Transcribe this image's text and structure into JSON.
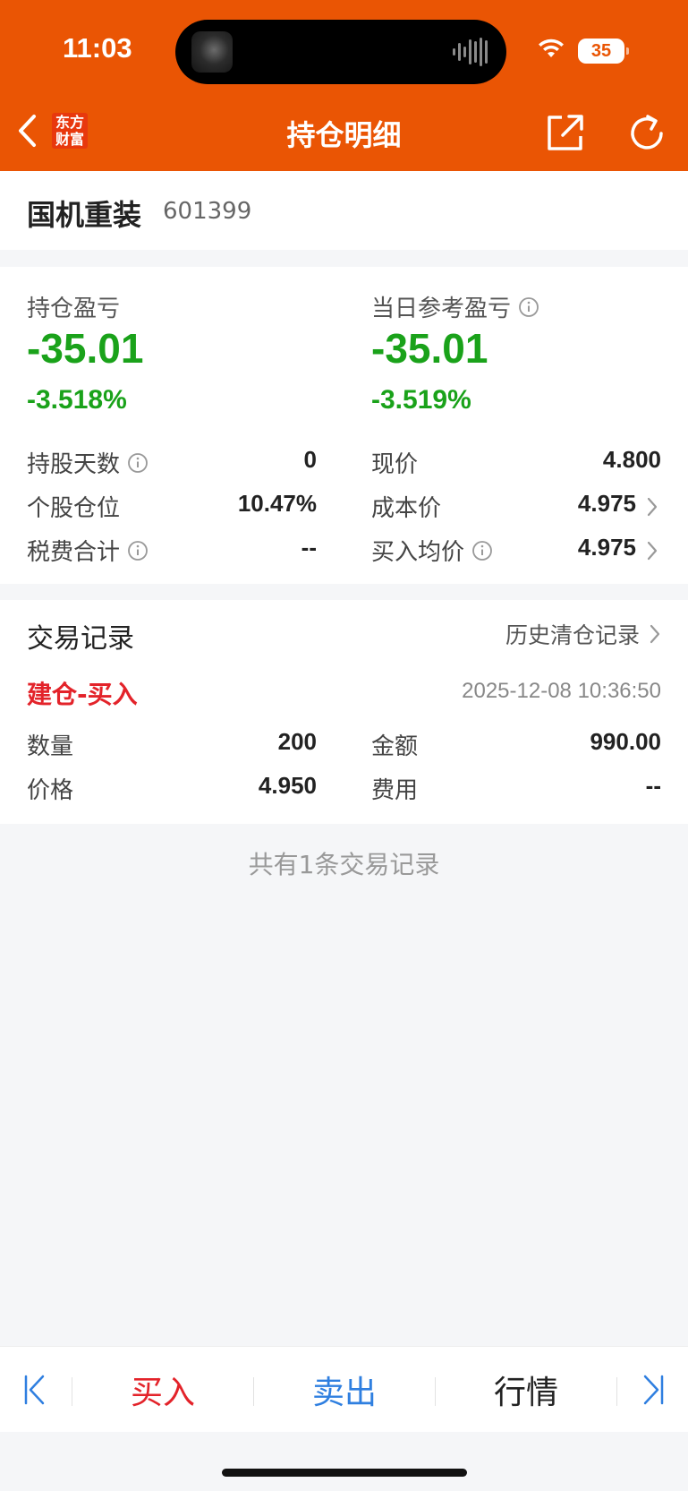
{
  "status": {
    "time": "11:03",
    "battery": "35"
  },
  "header": {
    "title": "持仓明细",
    "logo_line1": "东方",
    "logo_line2": "财富"
  },
  "stock": {
    "name": "国机重装",
    "code": "601399"
  },
  "holdings": {
    "position_pl_label": "持仓盈亏",
    "position_pl_value": "-35.01",
    "position_pl_pct": "-3.518%",
    "daily_pl_label": "当日参考盈亏",
    "daily_pl_value": "-35.01",
    "daily_pl_pct": "-3.519%",
    "rows_left": [
      {
        "label": "持股天数",
        "value": "0",
        "info": true
      },
      {
        "label": "个股仓位",
        "value": "10.47%",
        "info": false
      },
      {
        "label": "税费合计",
        "value": "--",
        "info": true
      }
    ],
    "rows_right": [
      {
        "label": "现价",
        "value": "4.800",
        "info": false,
        "chevron": false
      },
      {
        "label": "成本价",
        "value": "4.975",
        "info": false,
        "chevron": true
      },
      {
        "label": "买入均价",
        "value": "4.975",
        "info": true,
        "chevron": true
      }
    ]
  },
  "trades": {
    "title": "交易记录",
    "history_link": "历史清仓记录",
    "record": {
      "type": "建仓-买入",
      "time": "2025-12-08 10:36:50",
      "qty_label": "数量",
      "qty_value": "200",
      "amount_label": "金额",
      "amount_value": "990.00",
      "price_label": "价格",
      "price_value": "4.950",
      "fee_label": "费用",
      "fee_value": "--"
    },
    "summary": "共有1条交易记录"
  },
  "bottom_bar": {
    "buy": "买入",
    "sell": "卖出",
    "market": "行情"
  },
  "colors": {
    "brand": "#ea5504",
    "loss": "#1aa21a",
    "buy": "#e3232a",
    "sell": "#2f7fe0"
  }
}
